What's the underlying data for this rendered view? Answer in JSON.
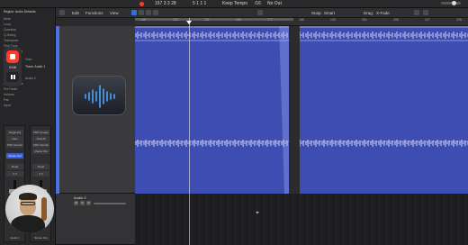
{
  "transport": {
    "position": "157 3 3 28",
    "tempo": "5 1 1 1",
    "tempo_mode": "Keep Tempo",
    "signature": "/16",
    "input": "No Out"
  },
  "toolbar": {
    "edit": "Edit",
    "functions": "Functions",
    "view": "View",
    "snap_label": "Snap:",
    "snap_value": "Smart",
    "drag_label": "Drag:",
    "drag_value": "X-Fade"
  },
  "ruler": {
    "ticks": [
      "145",
      "153",
      "161",
      "169",
      "177",
      "185",
      "193",
      "201",
      "209",
      "217",
      "225"
    ]
  },
  "inspector": {
    "header": "Region: Audio Defaults",
    "rows": [
      "Mute",
      "Loop",
      "Quantize",
      "Q-Swing",
      "Transpose",
      "Fine Tune",
      "Flex & Follow",
      "Gain",
      "Track: Audio 1",
      "Audio 2",
      "Flatten Sends",
      "Pre Fader",
      "Volume",
      "Pan",
      "Input"
    ],
    "recorder_time": "0:08",
    "strip1": {
      "slots": [
        "Single EQ",
        "Gain",
        "PDP Varnish",
        "Stereo Out"
      ],
      "read": "Read",
      "value": "0.0",
      "name": "Audio 1"
    },
    "strip2": {
      "slots": [
        "PDP Omega",
        "Plate B",
        "PDP Varnish",
        "Master Pla"
      ],
      "read": "Read",
      "value": "0.0",
      "name": "Stereo Out"
    }
  },
  "tracks": {
    "track2_name": "Audio 2",
    "mute": "M",
    "solo": "S",
    "rec": "R"
  },
  "colors": {
    "region": "#3e4db1",
    "accent": "#4a72e8",
    "record": "#ff3b30"
  }
}
